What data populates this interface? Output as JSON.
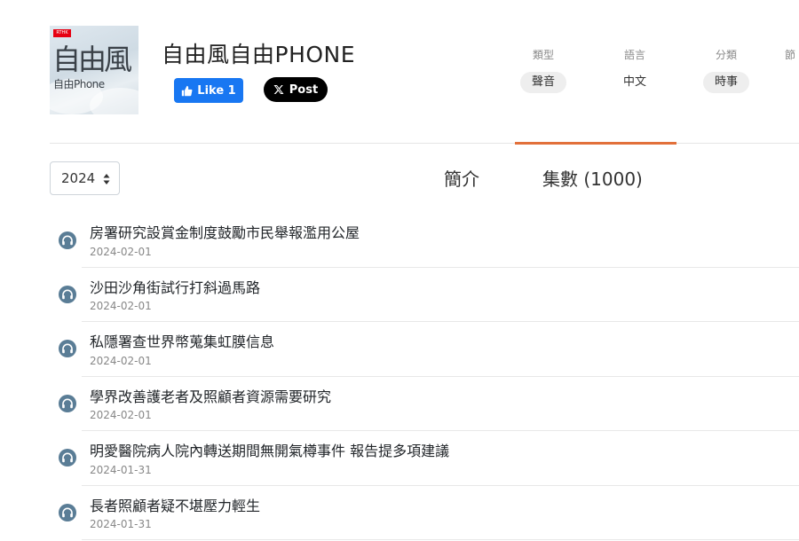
{
  "podcast": {
    "title": "自由風自由PHONE",
    "logo": {
      "badge": "RTHK",
      "main_text": "自由風",
      "sub_text": "自由Phone"
    }
  },
  "social": {
    "like_label": "Like 1",
    "post_label": "Post"
  },
  "meta": [
    {
      "label": "類型",
      "value": "聲音"
    },
    {
      "label": "語言",
      "value": "中文"
    },
    {
      "label": "分類",
      "value": "時事"
    },
    {
      "label": "節"
    }
  ],
  "year_select": {
    "value": "2024"
  },
  "tabs": [
    {
      "label": "簡介",
      "active": false
    },
    {
      "label": "集數 (1000)",
      "active": true
    }
  ],
  "episodes": [
    {
      "title": "房署研究設賞金制度鼓勵市民舉報濫用公屋",
      "date": "2024-02-01"
    },
    {
      "title": "沙田沙角街試行打斜過馬路",
      "date": "2024-02-01"
    },
    {
      "title": "私隱署查世界幣蒐集虹膜信息",
      "date": "2024-02-01"
    },
    {
      "title": "學界改善護老者及照顧者資源需要研究",
      "date": "2024-02-01"
    },
    {
      "title": "明愛醫院病人院內轉送期間無開氣樽事件 報告提多項建議",
      "date": "2024-01-31"
    },
    {
      "title": "長者照顧者疑不堪壓力輕生",
      "date": "2024-01-31"
    }
  ],
  "colors": {
    "accent": "#e2703a",
    "facebook": "#1877f2",
    "x": "#000000",
    "episode_icon": "#5a7d96"
  },
  "icons": {
    "like": "thumbs-up-icon",
    "post": "x-logo-icon",
    "select": "caret-updown-icon",
    "episode": "headphones-icon"
  }
}
